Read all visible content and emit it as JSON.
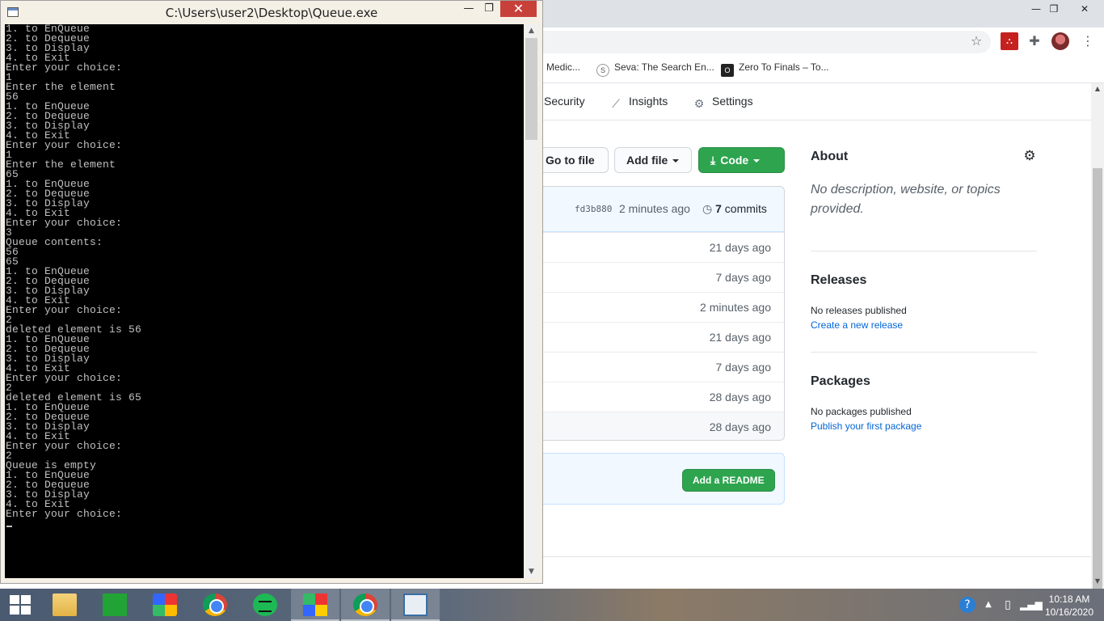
{
  "console": {
    "title": "C:\\Users\\user2\\Desktop\\Queue.exe",
    "lines": [
      "1. to EnQueue",
      "2. to Dequeue",
      "3. to Display",
      "4. to Exit",
      "Enter your choice:",
      "1",
      "Enter the element",
      "56",
      "1. to EnQueue",
      "2. to Dequeue",
      "3. to Display",
      "4. to Exit",
      "Enter your choice:",
      "1",
      "Enter the element",
      "65",
      "1. to EnQueue",
      "2. to Dequeue",
      "3. to Display",
      "4. to Exit",
      "Enter your choice:",
      "3",
      "Queue contents:",
      "56",
      "65",
      "1. to EnQueue",
      "2. to Dequeue",
      "3. to Display",
      "4. to Exit",
      "Enter your choice:",
      "2",
      "deleted element is 56",
      "1. to EnQueue",
      "2. to Dequeue",
      "3. to Display",
      "4. to Exit",
      "Enter your choice:",
      "2",
      "deleted element is 65",
      "1. to EnQueue",
      "2. to Dequeue",
      "3. to Display",
      "4. to Exit",
      "Enter your choice:",
      "2",
      "Queue is empty",
      "1. to EnQueue",
      "2. to Dequeue",
      "3. to Display",
      "4. to Exit",
      "Enter your choice:"
    ]
  },
  "browser": {
    "bookmarks": [
      {
        "label": "Medic...",
        "icon": "page-icon"
      },
      {
        "label": "Seva: The Search En...",
        "icon": "seva-icon",
        "glyph": "S"
      },
      {
        "label": "Zero To Finals – To...",
        "icon": "zero-icon",
        "glyph": "O"
      }
    ],
    "tabs": {
      "security": "Security",
      "insights": "Insights",
      "settings": "Settings"
    },
    "buttons": {
      "go_to_file": "Go to file",
      "add_file": "Add file",
      "code": "Code",
      "add_readme": "Add a README"
    },
    "latest_commit": {
      "sha": "fd3b880",
      "ago": "2 minutes ago",
      "count": "7",
      "count_label": "commits"
    },
    "file_rows": [
      "21 days ago",
      "7 days ago",
      "2 minutes ago",
      "21 days ago",
      "7 days ago",
      "28 days ago",
      "28 days ago"
    ],
    "about": {
      "heading": "About",
      "description": "No description, website, or topics provided."
    },
    "releases": {
      "heading": "Releases",
      "status": "No releases published",
      "link": "Create a new release"
    },
    "packages": {
      "heading": "Packages",
      "status": "No packages published",
      "link": "Publish your first package"
    }
  },
  "taskbar": {
    "time": "10:18 AM",
    "date": "10/16/2020",
    "apps": [
      "start-button",
      "file-explorer",
      "microsoft-store",
      "puzzle-app",
      "chrome",
      "spotify",
      "multicolor-app",
      "chrome-profile",
      "notepad-app"
    ]
  },
  "colors": {
    "console_bg": "#000000",
    "console_text": "#c0c0c0",
    "github_green": "#2ea44f",
    "link_blue": "#0366d6"
  }
}
